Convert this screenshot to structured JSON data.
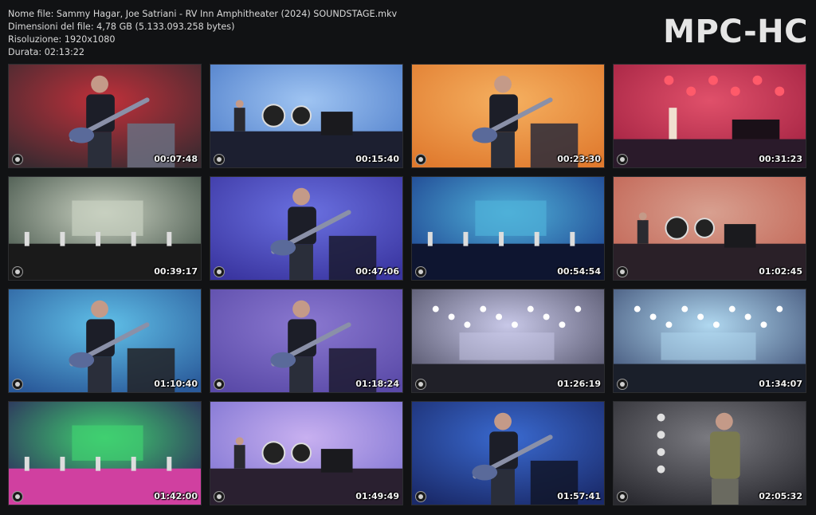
{
  "header": {
    "file_name": "Nome file: Sammy Hagar, Joe Satriani - RV Inn Amphitheater (2024) SOUNDSTAGE.mkv",
    "file_size": "Dimensioni del file: 4,78 GB (5.133.093.258 bytes)",
    "resolution": "Risoluzione: 1920x1080",
    "duration": "Durata: 02:13:22"
  },
  "logo": {
    "text": "MPC-HC"
  },
  "thumbnails": [
    {
      "time": "00:07:48",
      "palette": {
        "bg": "#3a2a30",
        "glow": "#c0303a",
        "accent": "#6a6f80"
      },
      "icon": "guitarist-scene"
    },
    {
      "time": "00:15:40",
      "palette": {
        "bg": "#4a7ac8",
        "glow": "#9fc4f2",
        "accent": "#1c1f30"
      },
      "icon": "stage-drums-scene"
    },
    {
      "time": "00:23:30",
      "palette": {
        "bg": "#e07a2e",
        "glow": "#f5b060",
        "accent": "#2a2a3a"
      },
      "icon": "guitarist-scene"
    },
    {
      "time": "00:31:23",
      "palette": {
        "bg": "#a02040",
        "glow": "#e0506a",
        "accent": "#2a1a2a"
      },
      "icon": "stage-red-scene"
    },
    {
      "time": "00:39:17",
      "palette": {
        "bg": "#3a4a40",
        "glow": "#c8d0c0",
        "accent": "#1a1a1a"
      },
      "icon": "stage-wide-scene"
    },
    {
      "time": "00:47:06",
      "palette": {
        "bg": "#3a35a0",
        "glow": "#6a70e0",
        "accent": "#1a1a30"
      },
      "icon": "guitarist-scene"
    },
    {
      "time": "00:54:54",
      "palette": {
        "bg": "#1a3a8a",
        "glow": "#4fb0d8",
        "accent": "#0e1530"
      },
      "icon": "stage-wide-scene"
    },
    {
      "time": "01:02:45",
      "palette": {
        "bg": "#c06050",
        "glow": "#d8a090",
        "accent": "#2a2028"
      },
      "icon": "stage-drums-scene"
    },
    {
      "time": "01:10:40",
      "palette": {
        "bg": "#2a5a9a",
        "glow": "#60c0e8",
        "accent": "#222226"
      },
      "icon": "guitarist-scene"
    },
    {
      "time": "01:18:24",
      "palette": {
        "bg": "#5a4aa8",
        "glow": "#8a78d0",
        "accent": "#1c1a30"
      },
      "icon": "guitarist-scene"
    },
    {
      "time": "01:26:19",
      "palette": {
        "bg": "#4a4a60",
        "glow": "#c8c8e8",
        "accent": "#202028"
      },
      "icon": "stage-lights-scene"
    },
    {
      "time": "01:34:07",
      "palette": {
        "bg": "#3a4a70",
        "glow": "#b0d8f0",
        "accent": "#1a1f2a"
      },
      "icon": "stage-lights-scene"
    },
    {
      "time": "01:42:00",
      "palette": {
        "bg": "#2a1a5a",
        "glow": "#40d070",
        "accent": "#d040a0"
      },
      "icon": "stage-wide-scene"
    },
    {
      "time": "01:49:49",
      "palette": {
        "bg": "#7a70d0",
        "glow": "#c8b0f0",
        "accent": "#2a2030"
      },
      "icon": "stage-drums-scene"
    },
    {
      "time": "01:57:41",
      "palette": {
        "bg": "#1a2a6a",
        "glow": "#3a6ad0",
        "accent": "#101528"
      },
      "icon": "guitarist-scene"
    },
    {
      "time": "02:05:32",
      "palette": {
        "bg": "#2a2a30",
        "glow": "#7a7a80",
        "accent": "#141416"
      },
      "icon": "singer-scene"
    }
  ]
}
